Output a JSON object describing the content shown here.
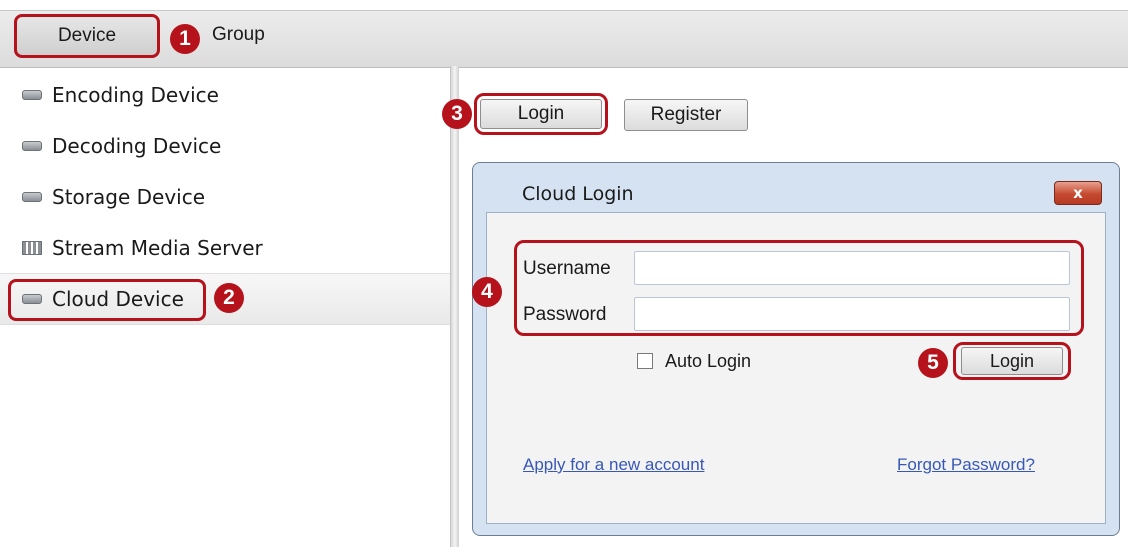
{
  "top_tabs": {
    "device": "Device",
    "group": "Group"
  },
  "sidebar": {
    "items": [
      {
        "label": "Encoding Device",
        "icon": "device-icon"
      },
      {
        "label": "Decoding Device",
        "icon": "device-icon"
      },
      {
        "label": "Storage Device",
        "icon": "device-icon"
      },
      {
        "label": "Stream Media Server",
        "icon": "server-icon"
      },
      {
        "label": "Cloud Device",
        "icon": "device-icon"
      }
    ]
  },
  "toolbar": {
    "login": "Login",
    "register": "Register"
  },
  "dialog": {
    "title": "Cloud Login",
    "close": "x",
    "username_label": "Username",
    "username_value": "",
    "password_label": "Password",
    "password_value": "",
    "auto_login": "Auto Login",
    "auto_login_checked": false,
    "login_button": "Login",
    "apply_link": "Apply for a new account",
    "forgot_link": "Forgot Password?"
  },
  "callouts": [
    "1",
    "2",
    "3",
    "4",
    "5"
  ],
  "colors": {
    "highlight": "#b5121b",
    "dialog_frame": "#d4e2f2",
    "link": "#3858b8"
  }
}
